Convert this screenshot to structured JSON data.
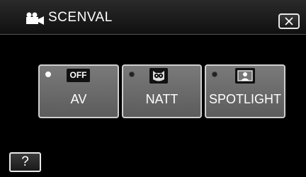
{
  "header": {
    "title": "SCENVAL",
    "mode_icon": "video-camera-icon",
    "close_icon": "close-icon"
  },
  "options": [
    {
      "label": "AV",
      "badge": "OFF",
      "icon": "off-icon",
      "selected": true
    },
    {
      "label": "NATT",
      "icon": "owl-icon",
      "selected": false
    },
    {
      "label": "SPOTLIGHT",
      "icon": "spotlight-icon",
      "selected": false
    }
  ],
  "footer": {
    "help_label": "?"
  },
  "colors": {
    "background": "#000000",
    "button": "#6a6a6a",
    "border": "#cfcfcf",
    "text": "#ffffff"
  }
}
